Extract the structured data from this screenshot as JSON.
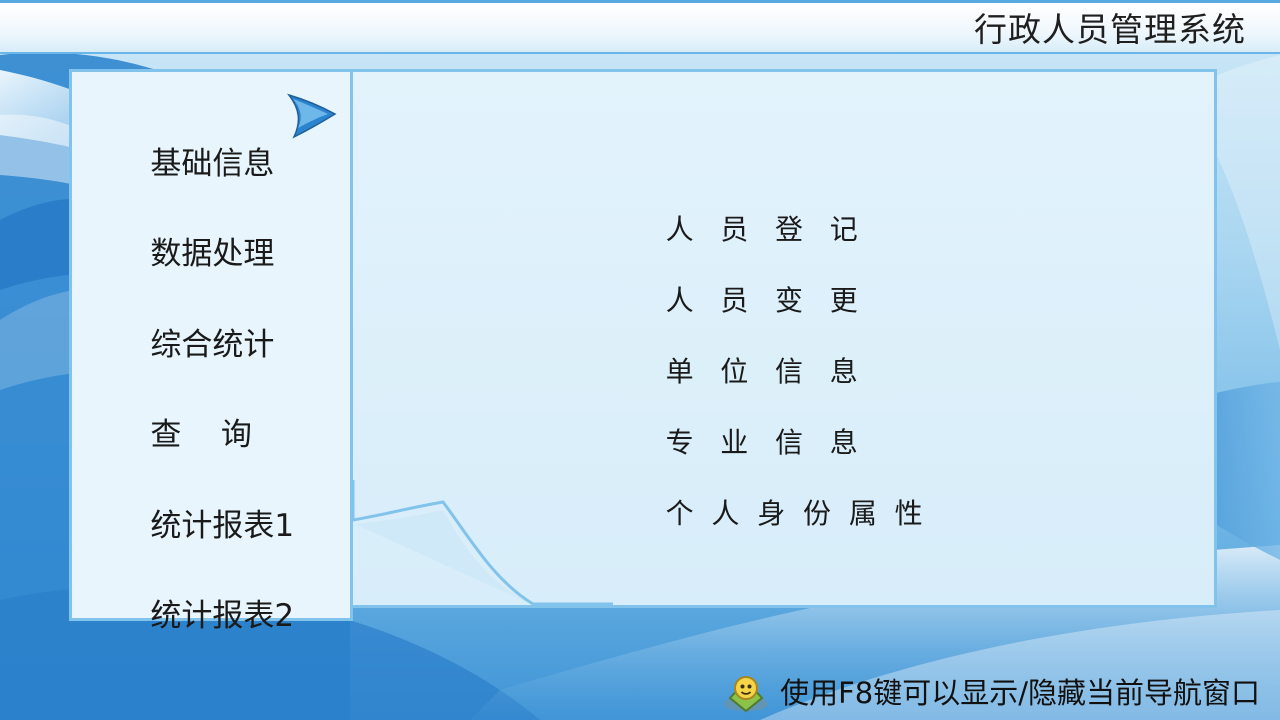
{
  "header": {
    "title": "行政人员管理系统"
  },
  "sidebar": {
    "active_index": 0,
    "items": [
      {
        "label": "基础信息",
        "active": true
      },
      {
        "label": "数据处理",
        "active": false
      },
      {
        "label": "综合统计",
        "active": false
      },
      {
        "label": "查    询",
        "active": false
      },
      {
        "label": "统计报表1",
        "active": false
      },
      {
        "label": "统计报表2",
        "active": false
      }
    ]
  },
  "content": {
    "items": [
      {
        "label": "人   员   登   记"
      },
      {
        "label": "人   员   变   更"
      },
      {
        "label": "单   位   信   息"
      },
      {
        "label": "专   业   信   息"
      },
      {
        "label": "个  人  身  份  属  性"
      }
    ]
  },
  "footer": {
    "hint": "使用F8键可以显示/隐藏当前导航窗口",
    "icon": "help-icon"
  },
  "colors": {
    "accent": "#58a9df",
    "panel_border": "#82c3ec",
    "nav_background": "#e8f5fc",
    "content_background": "#dcefFa"
  }
}
